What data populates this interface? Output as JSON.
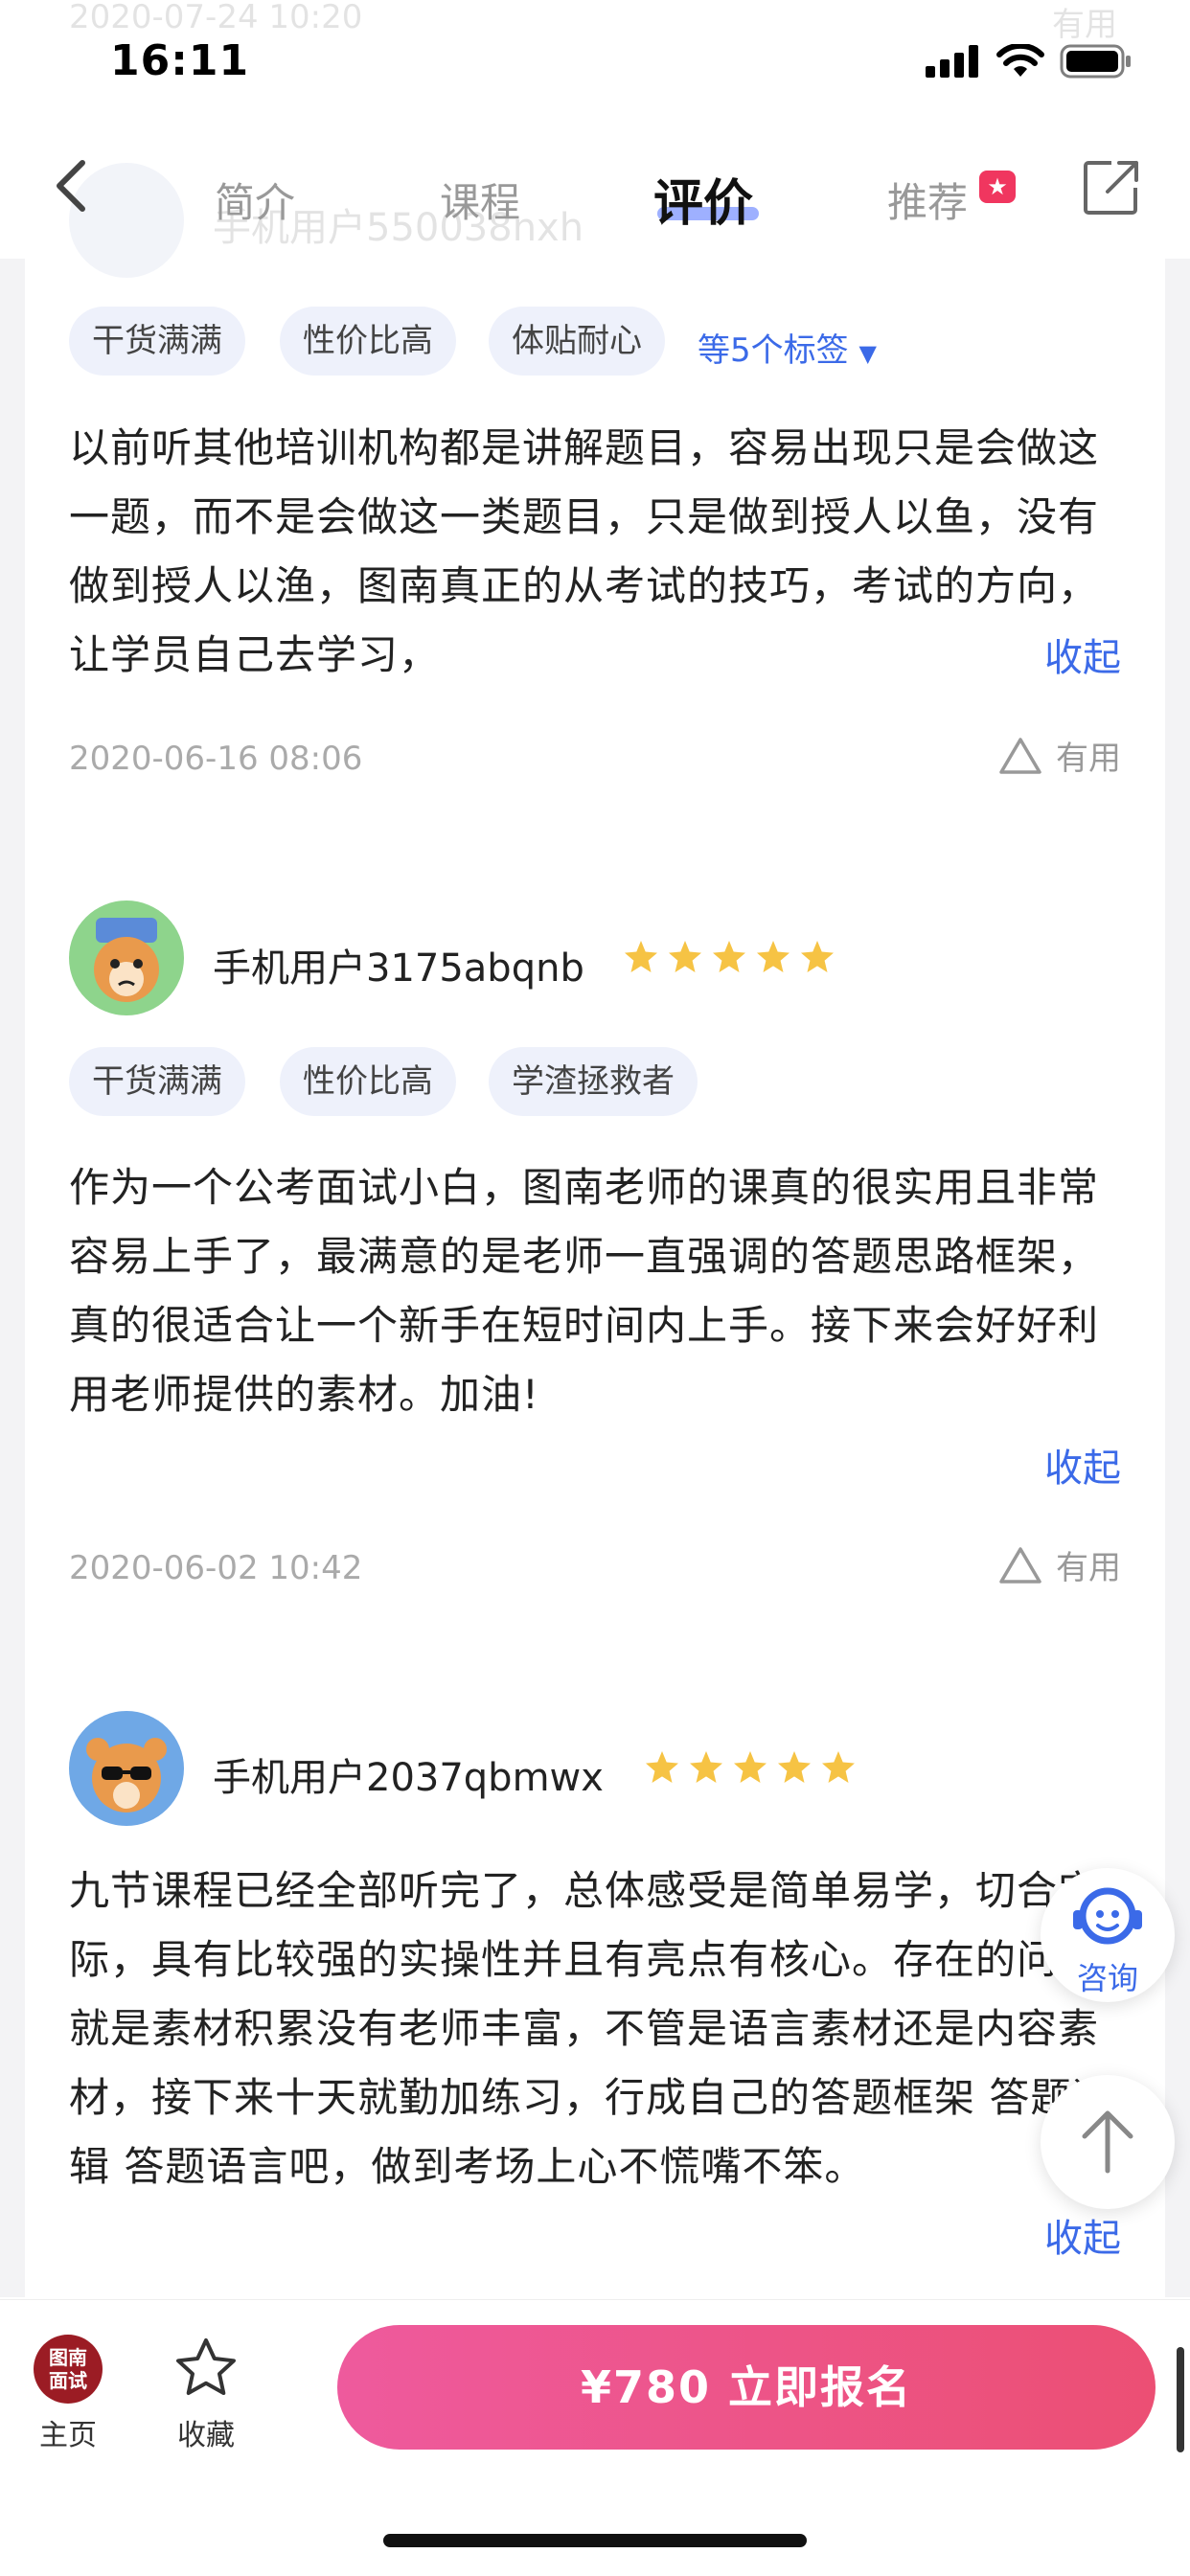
{
  "status_bar": {
    "time": "16:11"
  },
  "ghost": {
    "date": "2020-07-24 10:20",
    "useful": "有用",
    "username": "手机用户550038nxh"
  },
  "nav": {
    "tabs": [
      "简介",
      "课程",
      "评价",
      "推荐"
    ],
    "active_tab": "评价"
  },
  "reviews": [
    {
      "tags": [
        "干货满满",
        "性价比高",
        "体贴耐心"
      ],
      "more_tags": "等5个标签",
      "text": "以前听其他培训机构都是讲解题目，容易出现只是会做这一题，而不是会做这一类题目，只是做到授人以鱼，没有做到授人以渔，图南真正的从考试的技巧，考试的方向，让学员自己去学习，",
      "collapse": "收起",
      "date": "2020-06-16 08:06",
      "useful": "有用"
    },
    {
      "username": "手机用户3175abqnb",
      "rating": 5,
      "tags": [
        "干货满满",
        "性价比高",
        "学渣拯救者"
      ],
      "text": "作为一个公考面试小白，图南老师的课真的很实用且非常容易上手了，最满意的是老师一直强调的答题思路框架，真的很适合让一个新手在短时间内上手。接下来会好好利用老师提供的素材。加油!",
      "collapse": "收起",
      "date": "2020-06-02 10:42",
      "useful": "有用"
    },
    {
      "username": "手机用户2037qbmwx",
      "rating": 5,
      "text": "九节课程已经全部听完了，总体感受是简单易学，切合实际，具有比较强的实操性并且有亮点有核心。存在的问题就是素材积累没有老师丰富，不管是语言素材还是内容素材，接下来十天就勤加练习，行成自己的答题框架  答题逻辑  答题语言吧，做到考场上心不慌嘴不笨。",
      "collapse": "收起"
    }
  ],
  "float": {
    "consult": "咨询"
  },
  "bottom_bar": {
    "logo_text_1": "图南",
    "logo_text_2": "面试",
    "home": "主页",
    "favorite": "收藏",
    "signup": "¥780 立即报名"
  },
  "colors": {
    "accent": "#3b6ae8",
    "star": "#f6c344",
    "cta": "#ec4f74"
  }
}
